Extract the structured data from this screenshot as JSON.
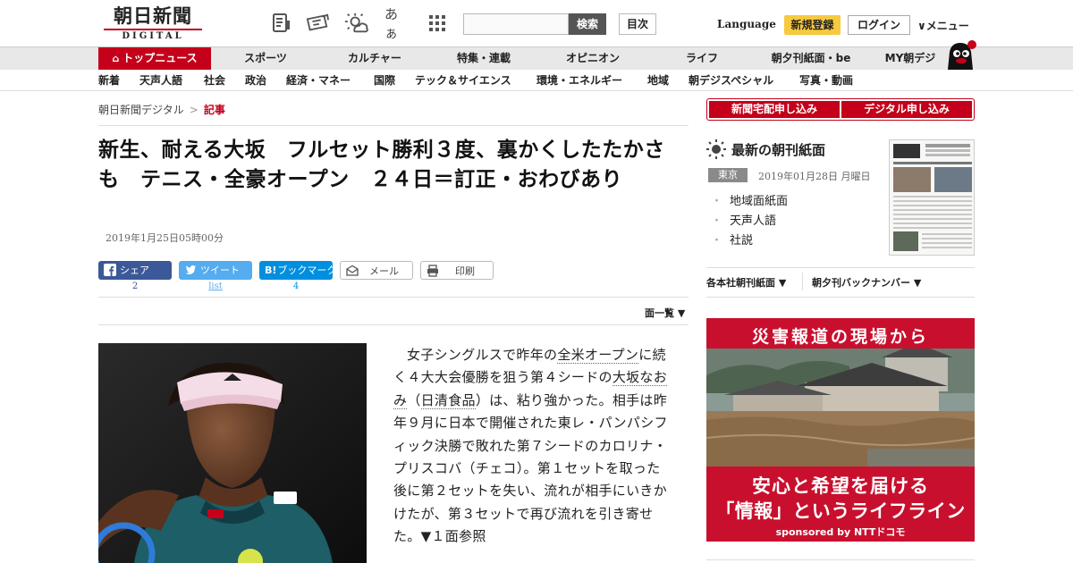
{
  "header": {
    "logo_jp": "朝日新聞",
    "logo_en": "DIGITAL",
    "font_size_label": "あぁ",
    "search": {
      "value": "",
      "button": "検索"
    },
    "toc": "目次",
    "language": "Language",
    "register": "新規登録",
    "login": "ログイン",
    "menu": "メニュー",
    "icons": [
      "memo-icon",
      "ticket-icon",
      "weather-icon",
      "font-size-icon",
      "grid-menu-icon",
      "menu-chevron-icon"
    ]
  },
  "main_nav": {
    "items": [
      "トップニュース",
      "スポーツ",
      "カルチャー",
      "特集・連載",
      "オピニオン",
      "ライフ",
      "朝夕刊紙面・be",
      "MY朝デジ"
    ]
  },
  "sub_nav": {
    "items": [
      "新着",
      "天声人語",
      "社会",
      "政治",
      "経済・マネー",
      "国際",
      "テック＆サイエンス",
      "環境・エネルギー",
      "地域",
      "朝デジスペシャル",
      "写真・動画"
    ]
  },
  "breadcrumb": {
    "home": "朝日新聞デジタル",
    "sep": ">",
    "current": "記事"
  },
  "article": {
    "title": "新生、耐える大坂　フルセット勝利３度、裏かくしたたかさも　テニス・全豪オープン　２４日＝訂正・おわびあり",
    "date": "2019年1月25日05時00分",
    "share": {
      "facebook": "シェア",
      "facebook_count": "2",
      "twitter": "ツイート",
      "twitter_list": "list",
      "hatena": "ブックマーク",
      "hatena_mark": "B!",
      "hatena_count": "4",
      "mail": "メール",
      "print": "印刷"
    },
    "page_list": "面一覧",
    "body": {
      "p1": "女子シングルスで昨年の",
      "kw1": "全米オープン",
      "p2": "に続く４大大会優勝を狙う第４シードの",
      "kw2": "大坂なおみ",
      "p3": "（",
      "kw3": "日清食品",
      "p4": "）は、粘り強かった。相手は昨年９月に日本で開催された東レ・パンパシフィック決勝で敗れた第７シードのカロリナ・プリスコバ（チェコ）。第１セットを取った後に第２セットを失い、流れが相手にいきかけたが、第３セットで再び流れを引き寄せた。▼１面参照"
    }
  },
  "sidebar": {
    "subscribe": [
      "新聞宅配申し込み",
      "デジタル申し込み"
    ],
    "morning_title": "最新の朝刊紙面",
    "region": "東京",
    "edition_date": "2019年01月28日 月曜日",
    "links": [
      "地域面紙面",
      "天声人語",
      "社説"
    ],
    "backnumber": [
      "各本社朝刊紙面",
      "朝夕刊バックナンバー"
    ],
    "ad": {
      "headline": "災害報道の現場から",
      "tagline1": "安心と希望を届ける",
      "tagline2": "「情報」というライフライン",
      "sponsor": "sponsored by NTTドコモ"
    }
  },
  "colors": {
    "brand_red": "#c4001a",
    "facebook": "#3b5998",
    "twitter": "#55acee",
    "hatena": "#008fde",
    "register_yellow": "#f7c93e",
    "nav_gray": "#e8e8e8"
  }
}
